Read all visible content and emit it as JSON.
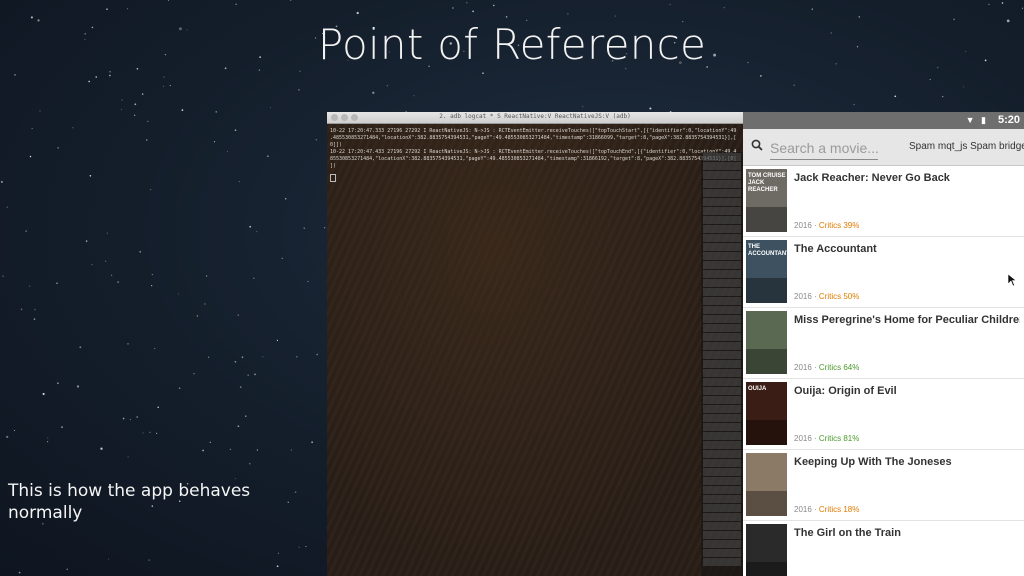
{
  "slide": {
    "title": "Point of Reference",
    "caption": "This is how the app behaves normally"
  },
  "terminal": {
    "title": "2. adb logcat * S ReactNative:V ReactNativeJS:V (adb)",
    "log_text": "10-22 17:20:47.333 27196 27292 I ReactNativeJS: N->JS : RCTEventEmitter.receiveTouches([\"topTouchStart\",[{\"identifier\":0,\"locationY\":49\n.485530853271484,\"locationX\":382.8835754394531,\"pageY\":49.485530853271484,\"timestamp\":31866099,\"target\":8,\"pageX\":382.8835754394531}],[\n0]])\n10-22 17:20:47.433 27196 27292 I ReactNativeJS: N->JS : RCTEventEmitter.receiveTouches([\"topTouchEnd\",[{\"identifier\":0,\"locationY\":49.4\n85530853271484,\"locationX\":382.8835754394531,\"pageY\":49.485530853271484,\"timestamp\":31866192,\"target\":8,\"pageX\":382.8835754394531}],[0]\n])"
  },
  "phone": {
    "status_time": "5:20",
    "search": {
      "placeholder": "Search a movie...",
      "hint": "Spam mqt_js Spam bridge"
    },
    "movies": [
      {
        "title": "Jack Reacher: Never Go Back",
        "year": "2016",
        "critics": "Critics 39%",
        "critics_color": "#e07b00",
        "poster_color": "#6e6a64",
        "poster_text": "TOM CRUISE JACK REACHER"
      },
      {
        "title": "The Accountant",
        "year": "2016",
        "critics": "Critics 50%",
        "critics_color": "#e07b00",
        "poster_color": "#3d5160",
        "poster_text": "THE ACCOUNTANT"
      },
      {
        "title": "Miss Peregrine's Home for Peculiar Children",
        "year": "2016",
        "critics": "Critics 64%",
        "critics_color": "#4a9a2a",
        "poster_color": "#5a6a52",
        "poster_text": ""
      },
      {
        "title": "Ouija: Origin of Evil",
        "year": "2016",
        "critics": "Critics 81%",
        "critics_color": "#4a9a2a",
        "poster_color": "#3a1d14",
        "poster_text": "OUIJA"
      },
      {
        "title": "Keeping Up With The Joneses",
        "year": "2016",
        "critics": "Critics 18%",
        "critics_color": "#e07b00",
        "poster_color": "#8a7a66",
        "poster_text": ""
      },
      {
        "title": "The Girl on the Train",
        "year": "",
        "critics": "",
        "critics_color": "#e07b00",
        "poster_color": "#2a2a2a",
        "poster_text": ""
      }
    ]
  }
}
